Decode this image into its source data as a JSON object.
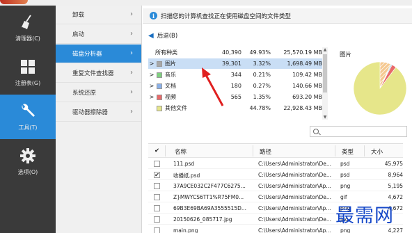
{
  "colors": {
    "accent": "#2a8ad8",
    "sidebar_bg": "#3a3a3a",
    "selected_row": "#c9def5",
    "annotation_red": "#e02020",
    "watermark": "#1447c8"
  },
  "sidebar": {
    "items": [
      {
        "icon": "broom-icon",
        "label": "清理器(C)"
      },
      {
        "icon": "registry-grid-icon",
        "label": "注册表(G)"
      },
      {
        "icon": "wrench-icon",
        "label": "工具(T)",
        "active": true
      },
      {
        "icon": "gear-icon",
        "label": "选项(O)"
      }
    ]
  },
  "tools_menu": {
    "items": [
      {
        "label": "卸载"
      },
      {
        "label": "启动"
      },
      {
        "label": "磁盘分析器",
        "active": true
      },
      {
        "label": "重复文件查找器"
      },
      {
        "label": "系统还原"
      },
      {
        "label": "驱动器擦除器"
      }
    ]
  },
  "info_bar": {
    "text": "扫描您的计算机查找正在使用磁盘空间的文件类型"
  },
  "back_button": {
    "label": "后退(B)"
  },
  "types_table": {
    "rows": [
      {
        "expand": "",
        "name": "所有种类",
        "count": "40,390",
        "percent": "49.93%",
        "size": "25,570.19 MB"
      },
      {
        "expand": ">",
        "color": "#a8a8a8",
        "name": "图片",
        "count": "39,301",
        "percent": "3.32%",
        "size": "1,698.49 MB",
        "selected": true
      },
      {
        "expand": ">",
        "color": "#7fd07f",
        "name": "音乐",
        "count": "344",
        "percent": "0.21%",
        "size": "109.42 MB"
      },
      {
        "expand": ">",
        "color": "#8ab0e8",
        "name": "文档",
        "count": "180",
        "percent": "0.27%",
        "size": "140.66 MB"
      },
      {
        "expand": ">",
        "color": "#e86a6a",
        "name": "视频",
        "count": "565",
        "percent": "1.35%",
        "size": "693.20 MB"
      },
      {
        "expand": "",
        "color": "#e6e68a",
        "name": "其他文件",
        "count": "",
        "percent": "44.78%",
        "size": "22,928.43 MB"
      }
    ]
  },
  "pie_chart": {
    "title": "图片",
    "slices": [
      {
        "name": "图片",
        "percent": 3.32,
        "color": "#f0b070"
      },
      {
        "name": "音乐",
        "percent": 0.21,
        "color": "#7fd07f"
      },
      {
        "name": "文档",
        "percent": 0.27,
        "color": "#8ab0e8"
      },
      {
        "name": "视频",
        "percent": 1.35,
        "color": "#e86a6a"
      },
      {
        "name": "其他文件",
        "percent": 44.78,
        "color": "#e6e68a"
      }
    ]
  },
  "file_list": {
    "headers": {
      "check": "✔",
      "name": "名称",
      "path": "路径",
      "type": "类型",
      "size": "大小"
    },
    "rows": [
      {
        "checked": false,
        "name": "111.psd",
        "path": "C:\\Users\\Administrator\\De...",
        "type": "psd",
        "size": "45,975"
      },
      {
        "checked": true,
        "name": "收播纸.psd",
        "path": "C:\\Users\\Administrator\\De...",
        "type": "psd",
        "size": "8,964"
      },
      {
        "checked": false,
        "name": "37A9CE032C2F477C6275...",
        "path": "C:\\Users\\Administrator\\Ap...",
        "type": "png",
        "size": "5,195"
      },
      {
        "checked": false,
        "name": "Z}MWYCS6TT1%R75FM0...",
        "path": "C:\\Users\\Administrator\\De...",
        "type": "gif",
        "size": "4,672"
      },
      {
        "checked": false,
        "name": "69B3E69BA69A3555515D...",
        "path": "C:\\Users\\Administrator\\Ap...",
        "type": "png",
        "size": "4,672"
      },
      {
        "checked": false,
        "name": "20150626_085717.jpg",
        "path": "C:\\Users\\Administrator\\De...",
        "type": "jpg",
        "size": ""
      },
      {
        "checked": false,
        "name": "main.png",
        "path": "C:\\Users\\Administrator\\Ap...",
        "type": "png",
        "size": "4,227"
      }
    ]
  },
  "watermark": {
    "text": "最需网"
  }
}
